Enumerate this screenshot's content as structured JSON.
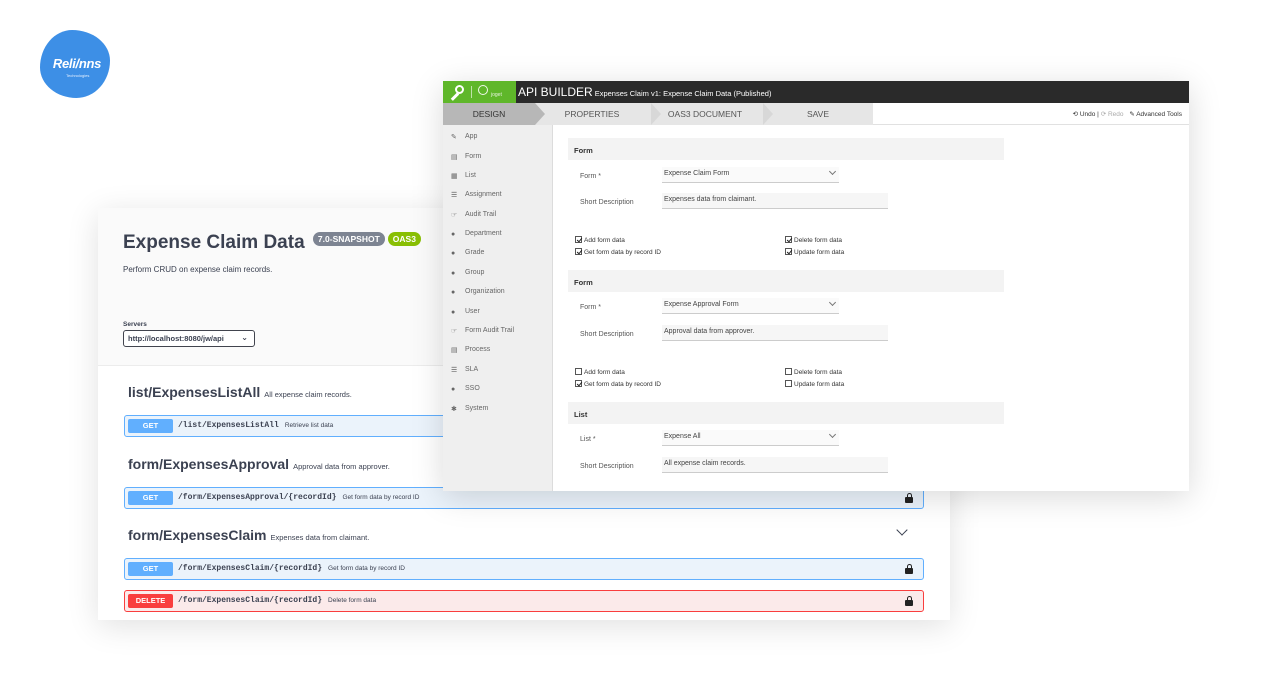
{
  "logo": {
    "text": "Reli/nns",
    "sub": "Technologies"
  },
  "swagger": {
    "title": "Expense Claim Data",
    "version_badge": "7.0-SNAPSHOT",
    "oas_badge": "OAS3",
    "description": "Perform CRUD on expense claim records.",
    "servers_label": "Servers",
    "server_value": "http://localhost:8080/jw/api",
    "sections": [
      {
        "name": "list/ExpensesListAll",
        "description": "All expense claim records."
      },
      {
        "name": "form/ExpensesApproval",
        "description": "Approval data from approver."
      },
      {
        "name": "form/ExpensesClaim",
        "description": "Expenses data from claimant."
      }
    ],
    "operations": [
      {
        "method": "GET",
        "path": "/list/ExpensesListAll",
        "summary": "Retrieve list data"
      },
      {
        "method": "GET",
        "path": "/form/ExpensesApproval/{recordId}",
        "summary": "Get form data by record ID"
      },
      {
        "method": "GET",
        "path": "/form/ExpensesClaim/{recordId}",
        "summary": "Get form data by record ID"
      },
      {
        "method": "DELETE",
        "path": "/form/ExpensesClaim/{recordId}",
        "summary": "Delete form data"
      }
    ]
  },
  "builder": {
    "title": "API BUILDER",
    "subtitle": "Expenses Claim v1: Expense Claim Data (Published)",
    "logo_text": "joget",
    "tabs": [
      "DESIGN",
      "PROPERTIES",
      "OAS3 DOCUMENT",
      "SAVE"
    ],
    "actions": {
      "undo": "Undo",
      "sep": "|",
      "redo": "Redo",
      "advanced": "Advanced Tools"
    },
    "sidebar": [
      "App",
      "Form",
      "List",
      "Assignment",
      "Audit Trail",
      "Department",
      "Grade",
      "Group",
      "Organization",
      "User",
      "Form Audit Trail",
      "Process",
      "SLA",
      "SSO",
      "System"
    ],
    "panels": [
      {
        "header": "Form",
        "select_label": "Form *",
        "select_value": "Expense Claim Form",
        "desc_label": "Short Description",
        "desc_value": "Expenses data from claimant.",
        "checks": [
          {
            "label": "Add form data",
            "checked": true
          },
          {
            "label": "Delete form data",
            "checked": true
          },
          {
            "label": "Get form data by record ID",
            "checked": true
          },
          {
            "label": "Update form data",
            "checked": true
          }
        ]
      },
      {
        "header": "Form",
        "select_label": "Form *",
        "select_value": "Expense Approval Form",
        "desc_label": "Short Description",
        "desc_value": "Approval data from approver.",
        "checks": [
          {
            "label": "Add form data",
            "checked": false
          },
          {
            "label": "Delete form data",
            "checked": false
          },
          {
            "label": "Get form data by record ID",
            "checked": true
          },
          {
            "label": "Update form data",
            "checked": false
          }
        ]
      },
      {
        "header": "List",
        "select_label": "List *",
        "select_value": "Expense All",
        "desc_label": "Short Description",
        "desc_value": "All expense claim records."
      }
    ]
  }
}
